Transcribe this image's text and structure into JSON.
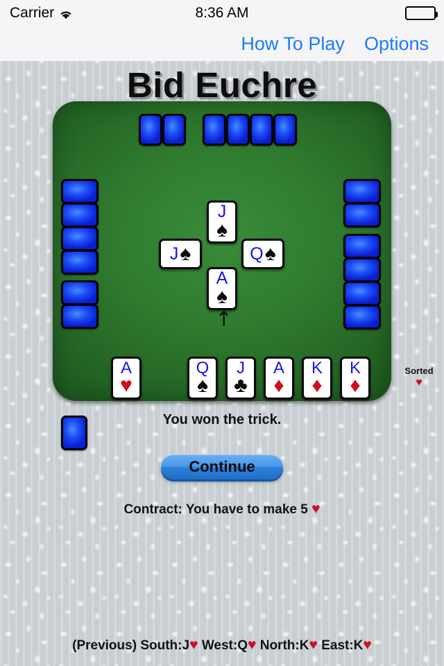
{
  "status_bar": {
    "carrier": "Carrier",
    "wifi_icon": "wifi-icon",
    "time": "8:36 AM",
    "battery_icon": "battery-full-icon"
  },
  "nav_bar": {
    "how_to_play": "How To Play",
    "options": "Options",
    "link_color": "#1a7bff"
  },
  "header": {
    "title": "Bid Euchre"
  },
  "table": {
    "felt_color": "#2f7a2f",
    "card_back_color": "#1b4bf5",
    "north_hand": {
      "group_a": 2,
      "group_b": 4
    },
    "west_hand": {
      "group_a": 4,
      "group_b": 2
    },
    "east_hand": {
      "group_a": 2,
      "group_b": 4
    },
    "kitty_card_backs": 1
  },
  "trick": {
    "north": {
      "rank": "J",
      "suit": "♠",
      "suit_name": "spades",
      "color": "black",
      "orientation": "vertical"
    },
    "west": {
      "rank": "J",
      "suit": "♠",
      "suit_name": "spades",
      "color": "black",
      "orientation": "horizontal"
    },
    "east": {
      "rank": "Q",
      "suit": "♠",
      "suit_name": "spades",
      "color": "black",
      "orientation": "horizontal"
    },
    "south": {
      "rank": "A",
      "suit": "♠",
      "suit_name": "spades",
      "color": "black",
      "orientation": "vertical"
    },
    "winner_arrow": "↑",
    "winner_arrow_name": "trick-winner-arrow-south"
  },
  "player_hand": {
    "cards": [
      {
        "rank": "A",
        "suit": "♥",
        "suit_name": "hearts",
        "color": "red"
      },
      {
        "rank": "Q",
        "suit": "♠",
        "suit_name": "spades",
        "color": "black"
      },
      {
        "rank": "J",
        "suit": "♣",
        "suit_name": "clubs",
        "color": "black"
      },
      {
        "rank": "A",
        "suit": "♦",
        "suit_name": "diamonds",
        "color": "red"
      },
      {
        "rank": "K",
        "suit": "♦",
        "suit_name": "diamonds",
        "color": "red"
      },
      {
        "rank": "K",
        "suit": "♦",
        "suit_name": "diamonds",
        "color": "red"
      }
    ]
  },
  "sorted_indicator": {
    "label": "Sorted",
    "suit": "♥",
    "suit_name": "hearts",
    "color": "#cc1020"
  },
  "messages": {
    "trick_result": "You won the trick.",
    "contract_prefix": "Contract: You have to make 5",
    "contract_suit": "♥",
    "previous_prefix": "(Previous)",
    "previous_plays": [
      {
        "seat": "South:",
        "rank": "J",
        "suit": "♥"
      },
      {
        "seat": "West:",
        "rank": "Q",
        "suit": "♥"
      },
      {
        "seat": "North:",
        "rank": "K",
        "suit": "♥"
      },
      {
        "seat": "East:",
        "rank": "K",
        "suit": "♥"
      }
    ]
  },
  "buttons": {
    "continue": "Continue"
  }
}
